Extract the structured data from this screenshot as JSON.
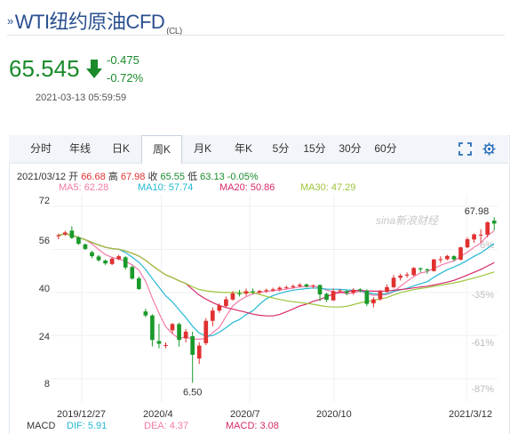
{
  "header": {
    "title": "WTI纽约原油CFD",
    "code": "(CL)",
    "price": "65.545",
    "change": "-0.475",
    "change_pct": "-0.72%",
    "timestamp": "2021-03-13 05:59:59"
  },
  "tabs": [
    "分时",
    "年线",
    "日K",
    "周K",
    "月K",
    "年K",
    "5分",
    "15分",
    "30分",
    "60分"
  ],
  "active_tab": "周K",
  "toolbar_icons": [
    "fullscreen-icon",
    "settings-icon"
  ],
  "info": {
    "date": "2021/03/12",
    "open_label": "开",
    "open": "66.68",
    "high_label": "高",
    "high": "67.98",
    "close_label": "收",
    "close": "65.55",
    "low_label": "低",
    "low": "63.13",
    "change_pct": "-0.05%"
  },
  "ma": {
    "ma5": "MA5: 62.28",
    "ma10": "MA10: 57.74",
    "ma20": "MA20: 50.86",
    "ma30": "MA30: 47.29"
  },
  "watermark": "sina新浪财经",
  "colors": {
    "up": "#e03030",
    "down": "#1a9a2b",
    "ma5": "#f47aa6",
    "ma10": "#24b8d3",
    "ma20": "#d62a6a",
    "ma30": "#9cc43a",
    "title": "#2a4f8f"
  },
  "chart_data": {
    "type": "candlestick",
    "y_ticks": [
      "72",
      "56",
      "40",
      "24",
      "8"
    ],
    "pct_ticks": [
      "6%",
      "-9%",
      "-35%",
      "-61%",
      "-87%"
    ],
    "x_labels": [
      "2019/12/27",
      "2020/4",
      "2020/7",
      "2020/10",
      "2021/3/12"
    ],
    "annotations": {
      "max": "67.98",
      "min": "6.50"
    },
    "ylim": [
      4,
      74
    ],
    "candles": [
      [
        60.9,
        61.3,
        59.8,
        61.9
      ],
      [
        61.6,
        62.3,
        61.0,
        62.9
      ],
      [
        63.0,
        60.3,
        59.9,
        64.6
      ],
      [
        60.5,
        58.1,
        57.7,
        60.9
      ],
      [
        57.9,
        56.2,
        55.8,
        58.2
      ],
      [
        55.0,
        53.5,
        52.8,
        55.5
      ],
      [
        53.4,
        52.0,
        51.5,
        54.0
      ],
      [
        51.9,
        50.8,
        50.2,
        52.3
      ],
      [
        50.6,
        52.6,
        50.2,
        53.1
      ],
      [
        52.4,
        53.5,
        52.0,
        54.0
      ],
      [
        53.1,
        49.3,
        48.5,
        53.5
      ],
      [
        49.5,
        45.2,
        44.8,
        50.0
      ],
      [
        45.3,
        41.3,
        41.0,
        46.0
      ],
      [
        33.0,
        31.5,
        30.8,
        34.0
      ],
      [
        31.5,
        22.4,
        20.0,
        32.0
      ],
      [
        22.0,
        21.0,
        19.3,
        28.4
      ],
      [
        20.5,
        20.5,
        19.3,
        21.5
      ],
      [
        26.0,
        28.3,
        24.8,
        28.7
      ],
      [
        28.3,
        22.4,
        19.9,
        28.8
      ],
      [
        23.0,
        25.5,
        21.5,
        26.5
      ],
      [
        23.8,
        16.9,
        6.5,
        25.5
      ],
      [
        15.5,
        20.3,
        13.5,
        21.5
      ],
      [
        21.2,
        29.5,
        20.5,
        30.5
      ],
      [
        29.5,
        33.3,
        27.5,
        34.5
      ],
      [
        33.3,
        35.2,
        32.5,
        36.0
      ],
      [
        35.0,
        37.5,
        34.5,
        38.5
      ],
      [
        37.4,
        39.7,
        37.0,
        40.5
      ],
      [
        39.7,
        39.5,
        38.5,
        41.0
      ],
      [
        39.6,
        40.5,
        38.8,
        41.5
      ],
      [
        40.5,
        40.3,
        39.5,
        41.5
      ],
      [
        40.0,
        40.6,
        39.5,
        41.0
      ],
      [
        40.6,
        40.9,
        40.0,
        41.5
      ],
      [
        40.8,
        41.2,
        40.3,
        41.8
      ],
      [
        41.2,
        41.8,
        40.5,
        42.3
      ],
      [
        41.8,
        42.0,
        41.2,
        42.6
      ],
      [
        42.0,
        42.4,
        41.5,
        43.0
      ],
      [
        42.4,
        42.9,
        42.0,
        43.5
      ],
      [
        43.0,
        42.3,
        41.8,
        43.4
      ],
      [
        42.3,
        42.6,
        41.5,
        43.0
      ],
      [
        42.8,
        39.3,
        36.8,
        43.0
      ],
      [
        39.5,
        37.3,
        36.5,
        40.0
      ],
      [
        37.1,
        40.5,
        36.9,
        41.5
      ],
      [
        40.6,
        40.8,
        39.7,
        41.3
      ],
      [
        40.5,
        39.8,
        39.0,
        41.0
      ],
      [
        39.9,
        41.0,
        39.2,
        41.6
      ],
      [
        41.2,
        40.8,
        40.0,
        41.6
      ],
      [
        40.7,
        35.8,
        35.0,
        41.2
      ],
      [
        36.0,
        37.5,
        34.5,
        38.3
      ],
      [
        37.5,
        40.4,
        37.0,
        41.0
      ],
      [
        40.2,
        42.0,
        40.0,
        43.0
      ],
      [
        42.0,
        45.5,
        41.5,
        46.5
      ],
      [
        45.5,
        46.3,
        44.5,
        47.0
      ],
      [
        46.3,
        46.7,
        45.5,
        47.5
      ],
      [
        46.5,
        49.1,
        46.0,
        49.5
      ],
      [
        49.0,
        48.6,
        47.5,
        49.3
      ],
      [
        48.6,
        48.2,
        47.0,
        49.0
      ],
      [
        48.0,
        52.3,
        47.8,
        52.5
      ],
      [
        52.2,
        52.4,
        51.0,
        53.5
      ],
      [
        52.4,
        53.6,
        52.0,
        54.0
      ],
      [
        53.5,
        52.3,
        51.5,
        53.9
      ],
      [
        52.2,
        56.8,
        52.0,
        57.0
      ],
      [
        56.8,
        59.8,
        56.5,
        60.5
      ],
      [
        59.7,
        61.6,
        58.5,
        62.0
      ],
      [
        61.5,
        61.5,
        58.5,
        63.5
      ],
      [
        61.5,
        66.1,
        60.5,
        66.4
      ],
      [
        66.7,
        65.6,
        63.1,
        68.0
      ]
    ]
  }
}
